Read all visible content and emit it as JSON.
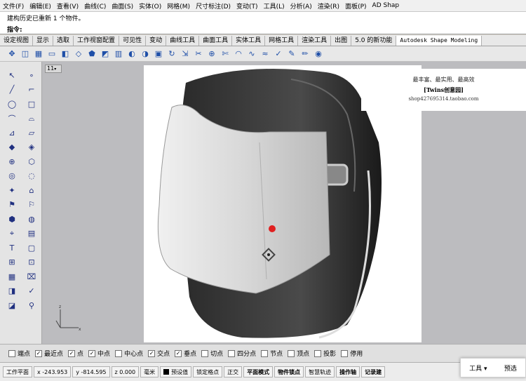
{
  "menubar": [
    "文件(F)",
    "编辑(E)",
    "查看(V)",
    "曲线(C)",
    "曲面(S)",
    "实体(O)",
    "网格(M)",
    "尺寸标注(D)",
    "变动(T)",
    "工具(L)",
    "分析(A)",
    "渲染(R)",
    "面板(P)",
    "AD Shap"
  ],
  "command": {
    "history": "建构历史已重新 1 个物件。",
    "prompt": "指令:"
  },
  "tabs": [
    "设定视图",
    "显示",
    "选取",
    "工作视窗配置",
    "可见性",
    "变动",
    "曲线工具",
    "曲面工具",
    "实体工具",
    "网格工具",
    "渲染工具",
    "出图",
    "5.0 的新功能",
    "Autodesk Shape Modeling"
  ],
  "toolbar_icons": [
    "move-icon",
    "box-icon",
    "grid-icon",
    "rect-icon",
    "cube-icon",
    "plane-icon",
    "patch-icon",
    "surface-icon",
    "mesh-icon",
    "sweep-icon",
    "loft-icon",
    "extrude-icon",
    "rotate-icon",
    "scale-icon",
    "split-icon",
    "join-icon",
    "trim-icon",
    "fillet-icon",
    "curve-icon",
    "blend-icon",
    "check-icon",
    "edit-icon",
    "pen-icon",
    "eye-icon"
  ],
  "viewport": {
    "label": "11",
    "ad": {
      "line1": "最丰富、最实用、最高效",
      "line2": "[Twins创意园]",
      "line3": "shop427695314.taobao.com"
    }
  },
  "snaps": [
    {
      "label": "端点",
      "checked": false
    },
    {
      "label": "最近点",
      "checked": true
    },
    {
      "label": "点",
      "checked": true
    },
    {
      "label": "中点",
      "checked": true
    },
    {
      "label": "中心点",
      "checked": false
    },
    {
      "label": "交点",
      "checked": true
    },
    {
      "label": "垂点",
      "checked": true
    },
    {
      "label": "切点",
      "checked": false
    },
    {
      "label": "四分点",
      "checked": false
    },
    {
      "label": "节点",
      "checked": false
    },
    {
      "label": "顶点",
      "checked": false
    },
    {
      "label": "投影",
      "checked": false
    },
    {
      "label": "停用",
      "checked": false
    }
  ],
  "status": {
    "plane": "工作平面",
    "x": "x -243.953",
    "y": "y -814.595",
    "z": "z 0.000",
    "unit": "毫米",
    "layer": "预设值",
    "lock_grid": "锁定格点",
    "ortho": "正交",
    "planar": "平面模式",
    "osnap": "物件锁点",
    "smarttrack": "智慧轨迹",
    "gumball": "操作轴",
    "record": "记录建"
  },
  "popup": {
    "tools": "工具",
    "preview": "预选"
  },
  "colors": {
    "viewport_bg": "#bcbcbf",
    "marker": "#e02020"
  }
}
